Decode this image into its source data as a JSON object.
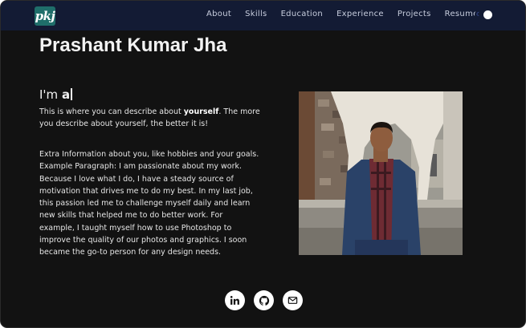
{
  "nav": {
    "logo_text": "pkj",
    "links": [
      "About",
      "Skills",
      "Education",
      "Experience",
      "Projects",
      "Resume"
    ],
    "theme_toggle_on": true
  },
  "hero": {
    "name": "Prashant Kumar Jha",
    "intro_prefix": "I'm ",
    "intro_typed": "a",
    "description_before": "This is where you can describe about ",
    "description_bold": "yourself",
    "description_after": ". The more you describe about yourself, the better it is!",
    "extra_info": "Extra Information about you, like hobbies and your goals. Example Paragraph: I am passionate about my work. Because I love what I do, I have a steady source of motivation that drives me to do my best. In my last job, this passion led me to challenge myself daily and learn new skills that helped me to do better work. For example, I taught myself how to use Photoshop to improve the quality of our photos and graphics. I soon became the go-to person for any design needs."
  },
  "socials": [
    {
      "icon": "linkedin-icon"
    },
    {
      "icon": "github-icon"
    },
    {
      "icon": "mail-icon"
    }
  ],
  "colors": {
    "background": "#121212",
    "navbar": "#131b34",
    "logo": "#1f6e6a",
    "text": "#f2f2f2"
  }
}
